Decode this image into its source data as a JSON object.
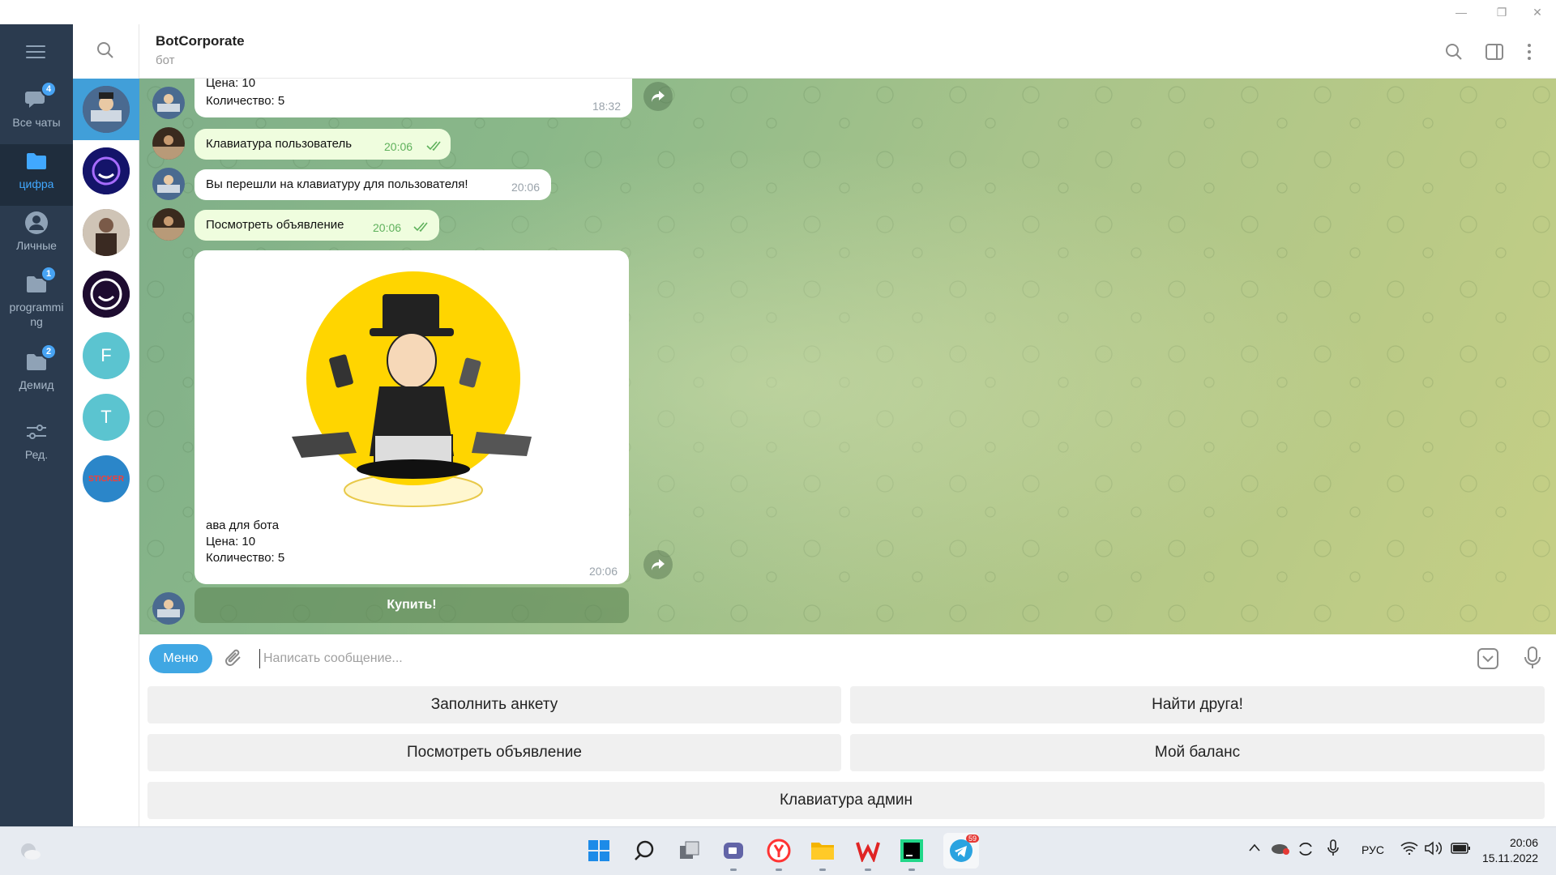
{
  "window": {
    "minimize": "—",
    "restore": "❐",
    "close": "✕"
  },
  "folders": [
    {
      "label": "Все чаты",
      "badge": "4",
      "icon": "chat-bubbles-icon"
    },
    {
      "label": "цифра",
      "badge": "",
      "icon": "folder-icon",
      "active": true
    },
    {
      "label": "Личные",
      "badge": "",
      "icon": "person-icon"
    },
    {
      "label": "programming",
      "label_line1": "programmi",
      "label_line2": "ng",
      "badge": "1",
      "icon": "folder-icon"
    },
    {
      "label": "Демид",
      "badge": "2",
      "icon": "folder-icon"
    },
    {
      "label": "Ред.",
      "badge": "",
      "icon": "sliders-icon"
    }
  ],
  "chats": [
    {
      "letter": "",
      "color": "#3c5a80"
    },
    {
      "letter": "",
      "color": "#1a1a6e"
    },
    {
      "letter": "",
      "color": "#8a7060"
    },
    {
      "letter": "",
      "color": "#2a1040"
    },
    {
      "letter": "F",
      "color": "#5bc4d0"
    },
    {
      "letter": "T",
      "color": "#5bc4d0"
    },
    {
      "letter": "STICKER",
      "color": "#2b86c9"
    }
  ],
  "header": {
    "title": "BotCorporate",
    "subtitle": "бот"
  },
  "messages": [
    {
      "line1": "Цена: 10",
      "line2": "Количество: 5",
      "time": "18:32",
      "dir": "in"
    },
    {
      "text": "Клавиатура пользователь",
      "time": "20:06",
      "dir": "out"
    },
    {
      "text": "Вы перешли на клавиатуру для пользователя!",
      "time": "20:06",
      "dir": "in"
    },
    {
      "text": "Посмотреть объявление",
      "time": "20:06",
      "dir": "out"
    },
    {
      "caption_line1": "ава для бота",
      "caption_line2": "Цена: 10",
      "caption_line3": "Количество: 5",
      "time": "20:06",
      "dir": "in"
    }
  ],
  "inline_button": "Купить!",
  "composer": {
    "menu": "Меню",
    "placeholder": "Написать сообщение..."
  },
  "keyboard": {
    "fill_form": "Заполнить анкету",
    "find_friend": "Найти друга!",
    "view_ad": "Посмотреть объявление",
    "my_balance": "Мой баланс",
    "admin_keyboard": "Клавиатура админ"
  },
  "taskbar": {
    "telegram_badge": "59",
    "lang": "РУС",
    "time": "20:06",
    "date": "15.11.2022"
  }
}
